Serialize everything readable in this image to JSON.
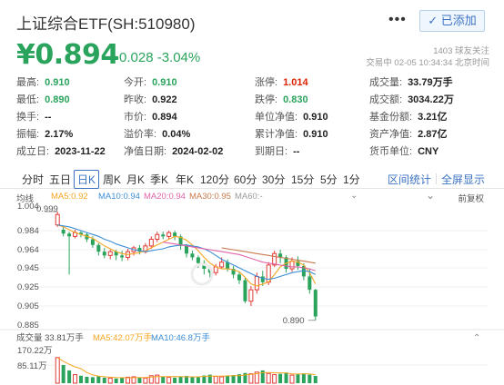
{
  "header": {
    "title": "上证综合ETF(SH:510980)",
    "more_label": "•••",
    "added_label": "✓ 已添加",
    "price": "¥0.894",
    "change": "-0.028 -3.04%",
    "followers": "1403 球友关注",
    "trade_time": "交易中 02-05 10:34:34 北京时间"
  },
  "stats": {
    "row1": [
      {
        "k": "最高:",
        "v": "0.910",
        "color": "green"
      },
      {
        "k": "今开:",
        "v": "0.910",
        "color": "green"
      },
      {
        "k": "涨停:",
        "v": "1.014",
        "color": "red"
      },
      {
        "k": "成交量:",
        "v": "33.79万手",
        "color": ""
      }
    ],
    "row2": [
      {
        "k": "最低:",
        "v": "0.890",
        "color": "green"
      },
      {
        "k": "昨收:",
        "v": "0.922",
        "color": ""
      },
      {
        "k": "跌停:",
        "v": "0.830",
        "color": "green"
      },
      {
        "k": "成交额:",
        "v": "3034.22万",
        "color": ""
      }
    ],
    "row3": [
      {
        "k": "换手:",
        "v": "--",
        "color": ""
      },
      {
        "k": "市价:",
        "v": "0.894",
        "color": ""
      },
      {
        "k": "单位净值:",
        "v": "0.910",
        "color": ""
      },
      {
        "k": "基金份额:",
        "v": "3.21亿",
        "color": ""
      }
    ],
    "row4": [
      {
        "k": "振幅:",
        "v": "2.17%",
        "color": ""
      },
      {
        "k": "溢价率:",
        "v": "0.04%",
        "color": ""
      },
      {
        "k": "累计净值:",
        "v": "0.910",
        "color": ""
      },
      {
        "k": "资产净值:",
        "v": "2.87亿",
        "color": ""
      }
    ],
    "row5": [
      {
        "k": "成立日:",
        "v": "2023-11-22",
        "color": ""
      },
      {
        "k": "净值日期:",
        "v": "2024-02-02",
        "color": ""
      },
      {
        "k": "到期日:",
        "v": "--",
        "color": ""
      },
      {
        "k": "货币单位:",
        "v": "CNY",
        "color": ""
      }
    ]
  },
  "tabs": {
    "items": [
      "分时",
      "五日",
      "日K",
      "周K",
      "月K",
      "季K",
      "年K",
      "120分",
      "60分",
      "30分",
      "15分",
      "5分",
      "1分"
    ],
    "active": "日K",
    "interval_stats": "区间统计",
    "fullscreen": "全屏显示"
  },
  "legend": {
    "label": "均线",
    "ma5": "MA5:0.92",
    "ma10": "MA10:0.94",
    "ma20": "MA20:0.94",
    "ma30": "MA30:0.95",
    "ma60": "MA60:-",
    "adjust": "前复权"
  },
  "colors": {
    "up": "#e03b35",
    "down": "#2aa45c",
    "ma5": "#f5a623",
    "ma10": "#3d8fd6",
    "ma20": "#e064a8",
    "ma30": "#c97a4e",
    "ma60": "#9a9a9a",
    "accent": "#3d73c2"
  },
  "chart_data": {
    "type": "candlestick",
    "ylim": [
      0.885,
      1.005
    ],
    "y_ticks": [
      "1.004",
      "0.999",
      "0.984",
      "0.964",
      "0.945",
      "0.925",
      "0.905",
      "0.885"
    ],
    "high_marker": "1.004",
    "low_marker": "0.890",
    "candles": [
      {
        "o": 0.99,
        "c": 1.001,
        "h": 1.004,
        "l": 0.988
      },
      {
        "o": 0.985,
        "c": 0.981,
        "h": 0.988,
        "l": 0.978
      },
      {
        "o": 0.981,
        "c": 0.978,
        "h": 0.983,
        "l": 0.938
      },
      {
        "o": 0.978,
        "c": 0.982,
        "h": 0.985,
        "l": 0.976
      },
      {
        "o": 0.982,
        "c": 0.98,
        "h": 0.984,
        "l": 0.977
      },
      {
        "o": 0.98,
        "c": 0.975,
        "h": 0.982,
        "l": 0.972
      },
      {
        "o": 0.975,
        "c": 0.969,
        "h": 0.978,
        "l": 0.966
      },
      {
        "o": 0.969,
        "c": 0.962,
        "h": 0.971,
        "l": 0.958
      },
      {
        "o": 0.962,
        "c": 0.958,
        "h": 0.966,
        "l": 0.955
      },
      {
        "o": 0.958,
        "c": 0.962,
        "h": 0.964,
        "l": 0.954
      },
      {
        "o": 0.962,
        "c": 0.958,
        "h": 0.964,
        "l": 0.953
      },
      {
        "o": 0.958,
        "c": 0.956,
        "h": 0.963,
        "l": 0.952
      },
      {
        "o": 0.956,
        "c": 0.962,
        "h": 0.965,
        "l": 0.953
      },
      {
        "o": 0.962,
        "c": 0.966,
        "h": 0.968,
        "l": 0.958
      },
      {
        "o": 0.966,
        "c": 0.962,
        "h": 0.969,
        "l": 0.959
      },
      {
        "o": 0.962,
        "c": 0.968,
        "h": 0.971,
        "l": 0.96
      },
      {
        "o": 0.968,
        "c": 0.975,
        "h": 0.978,
        "l": 0.965
      },
      {
        "o": 0.975,
        "c": 0.98,
        "h": 0.983,
        "l": 0.972
      },
      {
        "o": 0.98,
        "c": 0.978,
        "h": 0.983,
        "l": 0.975
      },
      {
        "o": 0.978,
        "c": 0.982,
        "h": 0.984,
        "l": 0.975
      },
      {
        "o": 0.982,
        "c": 0.978,
        "h": 0.984,
        "l": 0.974
      },
      {
        "o": 0.978,
        "c": 0.968,
        "h": 0.98,
        "l": 0.964
      },
      {
        "o": 0.968,
        "c": 0.96,
        "h": 0.97,
        "l": 0.956
      },
      {
        "o": 0.96,
        "c": 0.956,
        "h": 0.963,
        "l": 0.953
      },
      {
        "o": 0.956,
        "c": 0.95,
        "h": 0.958,
        "l": 0.945
      },
      {
        "o": 0.95,
        "c": 0.944,
        "h": 0.953,
        "l": 0.938
      },
      {
        "o": 0.944,
        "c": 0.94,
        "h": 0.947,
        "l": 0.935
      },
      {
        "o": 0.94,
        "c": 0.946,
        "h": 0.949,
        "l": 0.937
      },
      {
        "o": 0.946,
        "c": 0.951,
        "h": 0.956,
        "l": 0.944
      },
      {
        "o": 0.951,
        "c": 0.944,
        "h": 0.954,
        "l": 0.941
      },
      {
        "o": 0.944,
        "c": 0.938,
        "h": 0.947,
        "l": 0.934
      },
      {
        "o": 0.938,
        "c": 0.932,
        "h": 0.941,
        "l": 0.928
      },
      {
        "o": 0.932,
        "c": 0.91,
        "h": 0.935,
        "l": 0.908
      },
      {
        "o": 0.91,
        "c": 0.922,
        "h": 0.926,
        "l": 0.905
      },
      {
        "o": 0.922,
        "c": 0.936,
        "h": 0.94,
        "l": 0.918
      },
      {
        "o": 0.936,
        "c": 0.93,
        "h": 0.942,
        "l": 0.926
      },
      {
        "o": 0.93,
        "c": 0.948,
        "h": 0.951,
        "l": 0.927
      },
      {
        "o": 0.948,
        "c": 0.96,
        "h": 0.963,
        "l": 0.946
      },
      {
        "o": 0.96,
        "c": 0.956,
        "h": 0.964,
        "l": 0.95
      },
      {
        "o": 0.956,
        "c": 0.944,
        "h": 0.958,
        "l": 0.94
      },
      {
        "o": 0.944,
        "c": 0.952,
        "h": 0.956,
        "l": 0.941
      },
      {
        "o": 0.952,
        "c": 0.947,
        "h": 0.957,
        "l": 0.943
      },
      {
        "o": 0.947,
        "c": 0.936,
        "h": 0.95,
        "l": 0.932
      },
      {
        "o": 0.936,
        "c": 0.922,
        "h": 0.944,
        "l": 0.918
      },
      {
        "o": 0.922,
        "c": 0.894,
        "h": 0.923,
        "l": 0.89
      }
    ],
    "ma5": [
      0.99,
      0.988,
      0.985,
      0.982,
      0.98,
      0.978,
      0.976,
      0.972,
      0.968,
      0.965,
      0.962,
      0.96,
      0.959,
      0.96,
      0.961,
      0.963,
      0.966,
      0.969,
      0.972,
      0.975,
      0.978,
      0.977,
      0.974,
      0.969,
      0.963,
      0.956,
      0.95,
      0.946,
      0.944,
      0.944,
      0.943,
      0.941,
      0.935,
      0.928,
      0.926,
      0.928,
      0.93,
      0.938,
      0.946,
      0.95,
      0.952,
      0.951,
      0.948,
      0.94,
      0.928
    ],
    "ma10": [
      0.99,
      0.989,
      0.988,
      0.986,
      0.984,
      0.982,
      0.98,
      0.978,
      0.975,
      0.973,
      0.97,
      0.968,
      0.966,
      0.964,
      0.963,
      0.962,
      0.963,
      0.964,
      0.965,
      0.967,
      0.968,
      0.969,
      0.969,
      0.968,
      0.967,
      0.965,
      0.962,
      0.958,
      0.954,
      0.951,
      0.948,
      0.945,
      0.942,
      0.939,
      0.936,
      0.934,
      0.933,
      0.934,
      0.936,
      0.938,
      0.94,
      0.941,
      0.942,
      0.941,
      0.938
    ],
    "ma20": [
      null,
      null,
      null,
      null,
      null,
      null,
      null,
      null,
      null,
      null,
      null,
      null,
      null,
      null,
      null,
      null,
      null,
      null,
      0.972,
      0.971,
      0.97,
      0.969,
      0.968,
      0.967,
      0.966,
      0.965,
      0.964,
      0.963,
      0.962,
      0.961,
      0.96,
      0.959,
      0.957,
      0.955,
      0.953,
      0.951,
      0.95,
      0.949,
      0.948,
      0.947,
      0.946,
      0.946,
      0.945,
      0.944,
      0.942
    ],
    "ma30": [
      null,
      null,
      null,
      null,
      null,
      null,
      null,
      null,
      null,
      null,
      null,
      null,
      null,
      null,
      null,
      null,
      null,
      null,
      null,
      null,
      null,
      null,
      null,
      null,
      null,
      null,
      null,
      null,
      0.966,
      0.965,
      0.964,
      0.963,
      0.962,
      0.961,
      0.96,
      0.959,
      0.958,
      0.957,
      0.956,
      0.955,
      0.954,
      0.953,
      0.952,
      0.951,
      0.95
    ]
  },
  "volume": {
    "label": "成交量 33.81万手",
    "ma5": "MA5:42.07万手",
    "ma10": "MA10:46.8万手",
    "max_tick": "170.22万",
    "mid_tick": "85.11万",
    "max_value": 170.22,
    "values": [
      120,
      85,
      60,
      40,
      35,
      30,
      28,
      32,
      26,
      24,
      22,
      25,
      28,
      30,
      26,
      24,
      35,
      38,
      30,
      28,
      26,
      32,
      34,
      30,
      28,
      36,
      40,
      32,
      30,
      34,
      38,
      42,
      48,
      44,
      52,
      60,
      46,
      40,
      44,
      50,
      38,
      42,
      46,
      40,
      34
    ]
  }
}
